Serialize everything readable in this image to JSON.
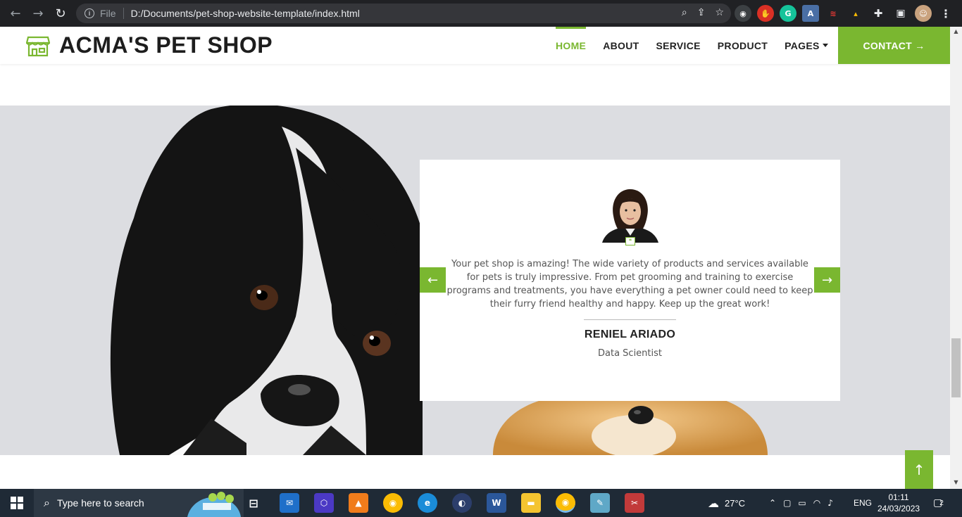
{
  "browser": {
    "scheme": "File",
    "url": "D:/Documents/pet-shop-website-template/index.html"
  },
  "site": {
    "brand": "ACMA'S  PET SHOP",
    "nav": [
      {
        "label": "HOME",
        "active": true
      },
      {
        "label": "ABOUT",
        "active": false
      },
      {
        "label": "SERVICE",
        "active": false
      },
      {
        "label": "PRODUCT",
        "active": false
      },
      {
        "label": "PAGES",
        "active": false
      }
    ],
    "contact_label": "CONTACT →",
    "accent_color": "#7ab730"
  },
  "testimonial": {
    "text": "Your pet shop is amazing! The wide variety of products and services available for pets is truly impressive. From pet grooming and training to exercise programs and treatments, you have everything a pet owner could need to keep their furry friend healthy and happy. Keep up the great work!",
    "author": "RENIEL ARIADO",
    "role": "Data Scientist",
    "prev_icon": "←",
    "next_icon": "→"
  },
  "back_to_top_icon": "↑",
  "taskbar": {
    "search_placeholder": "Type here to search",
    "weather": "27°C",
    "language": "ENG",
    "time": "01:11",
    "date": "24/03/2023",
    "notifications": "2"
  }
}
